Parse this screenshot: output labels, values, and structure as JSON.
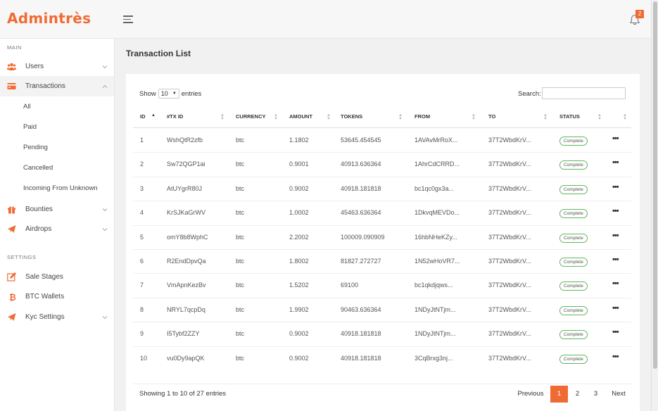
{
  "app": {
    "logo": "Admintrès",
    "notification_count": "2"
  },
  "sidebar": {
    "main_label": "MAIN",
    "settings_label": "SETTINGS",
    "users": "Users",
    "transactions": "Transactions",
    "sub": [
      "All",
      "Paid",
      "Pending",
      "Cancelled",
      "Incoming From Unknown"
    ],
    "bounties": "Bounties",
    "airdrops": "Airdrops",
    "sale_stages": "Sale Stages",
    "btc_wallets": "BTC Wallets",
    "kyc_settings": "Kyc Settings"
  },
  "page": {
    "title": "Transaction List"
  },
  "controls": {
    "show": "Show",
    "entries_value": "10",
    "entries": "entries",
    "search": "Search:"
  },
  "table": {
    "headers": [
      "ID",
      "#TX ID",
      "CURRENCY",
      "AMOUNT",
      "TOKENS",
      "FROM",
      "TO",
      "STATUS"
    ],
    "rows": [
      [
        "1",
        "WshQtR2zfb",
        "btc",
        "1.1802",
        "53645.454545",
        "1AVAvMrRoX...",
        "37T2WbdKrV...",
        "Complete"
      ],
      [
        "2",
        "Sw72QGP1ai",
        "btc",
        "0.9001",
        "40913.636364",
        "1AhrCdCRRD...",
        "37T2WbdKrV...",
        "Complete"
      ],
      [
        "3",
        "AtUYgrR80J",
        "btc",
        "0.9002",
        "40918.181818",
        "bc1qc0gx3a...",
        "37T2WbdKrV...",
        "Complete"
      ],
      [
        "4",
        "KrSJKaGrWV",
        "btc",
        "1.0002",
        "45463.636364",
        "1DkvqMEVDo...",
        "37T2WbdKrV...",
        "Complete"
      ],
      [
        "5",
        "omY8b8WphC",
        "btc",
        "2.2002",
        "100009.090909",
        "16hbNHeKZy...",
        "37T2WbdKrV...",
        "Complete"
      ],
      [
        "6",
        "R2EndDpvQa",
        "btc",
        "1.8002",
        "81827.272727",
        "1N52wHoVR7...",
        "37T2WbdKrV...",
        "Complete"
      ],
      [
        "7",
        "VmApnKezBv",
        "btc",
        "1.5202",
        "69100",
        "bc1qkdjqws...",
        "37T2WbdKrV...",
        "Complete"
      ],
      [
        "8",
        "NRYL7qcpDq",
        "btc",
        "1.9902",
        "90463.636364",
        "1NDyJtNTjm...",
        "37T2WbdKrV...",
        "Complete"
      ],
      [
        "9",
        "I5Tybf2ZZY",
        "btc",
        "0.9002",
        "40918.181818",
        "1NDyJtNTjm...",
        "37T2WbdKrV...",
        "Complete"
      ],
      [
        "10",
        "vu0Dy9apQK",
        "btc",
        "0.9002",
        "40918.181818",
        "3CqBrxg3nj...",
        "37T2WbdKrV...",
        "Complete"
      ]
    ]
  },
  "footer": {
    "info": "Showing 1 to 10 of 27 entries",
    "previous": "Previous",
    "pages": [
      "1",
      "2",
      "3"
    ],
    "next": "Next"
  },
  "colors": {
    "accent": "#f06b34",
    "status_border": "#5cb85c"
  }
}
